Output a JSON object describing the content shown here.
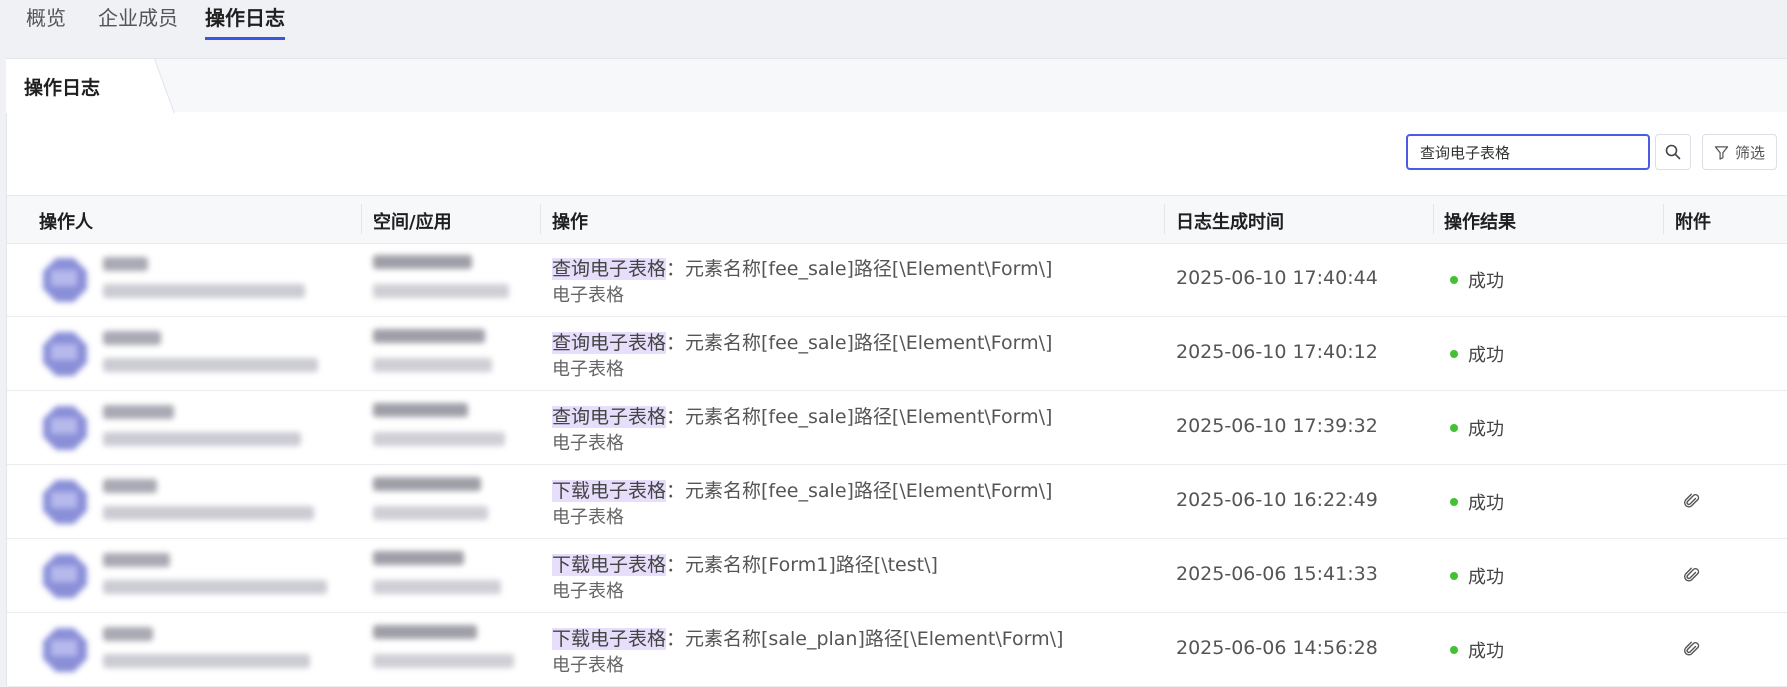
{
  "top_tabs": [
    {
      "label": "概览"
    },
    {
      "label": "企业成员"
    },
    {
      "label": "操作日志"
    }
  ],
  "panel_tab": {
    "label": "操作日志"
  },
  "search": {
    "value": "查询电子表格"
  },
  "filter": {
    "label": "筛选"
  },
  "table": {
    "headers": [
      "操作人",
      "空间/应用",
      "操作",
      "日志生成时间",
      "操作结果",
      "附件"
    ],
    "rows": [
      {
        "action": "查询电子表格",
        "detail": "：元素名称[fee_sale]路径[\\Element\\Form\\]",
        "type": "电子表格",
        "time": "2025-06-10 17:40:44",
        "result": "成功",
        "attachment": false
      },
      {
        "action": "查询电子表格",
        "detail": "：元素名称[fee_sale]路径[\\Element\\Form\\]",
        "type": "电子表格",
        "time": "2025-06-10 17:40:12",
        "result": "成功",
        "attachment": false
      },
      {
        "action": "查询电子表格",
        "detail": "：元素名称[fee_sale]路径[\\Element\\Form\\]",
        "type": "电子表格",
        "time": "2025-06-10 17:39:32",
        "result": "成功",
        "attachment": false
      },
      {
        "action": "下载电子表格",
        "detail": "：元素名称[fee_sale]路径[\\Element\\Form\\]",
        "type": "电子表格",
        "time": "2025-06-10 16:22:49",
        "result": "成功",
        "attachment": true
      },
      {
        "action": "下载电子表格",
        "detail": "：元素名称[Form1]路径[\\test\\]",
        "type": "电子表格",
        "time": "2025-06-06 15:41:33",
        "result": "成功",
        "attachment": true
      },
      {
        "action": "下载电子表格",
        "detail": "：元素名称[sale_plan]路径[\\Element\\Form\\]",
        "type": "电子表格",
        "time": "2025-06-06 14:56:28",
        "result": "成功",
        "attachment": true
      }
    ]
  },
  "colors": {
    "accent": "#3c55e0",
    "highlight": "#e6defa",
    "success": "#43c132",
    "avatar": "#8a8fd8"
  },
  "icons": {
    "search": "search-icon",
    "filter": "filter-icon",
    "attachment": "paperclip-icon"
  }
}
